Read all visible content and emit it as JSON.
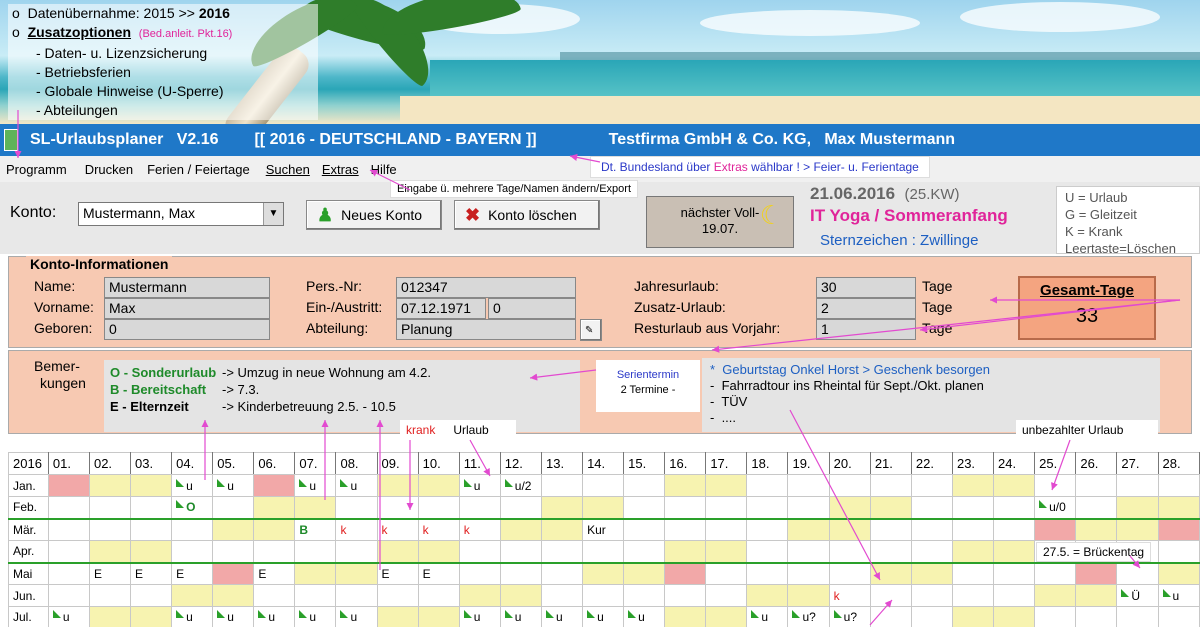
{
  "intro": {
    "line1_prefix": "Datenübernahme: 2015  >> ",
    "line1_bold": "2016",
    "line2_title": "Zusatzoptionen",
    "line2_note": "(Bed.anleit. Pkt.16)",
    "items": [
      "- Daten-  u. Lizenzsicherung",
      "- Betriebsferien",
      "- Globale Hinweise (U-Sperre)",
      "- Abteilungen"
    ]
  },
  "titlebar": {
    "app": "SL-Urlaubsplaner   V2.16",
    "region": "[[ 2016 - DEUTSCHLAND - BAYERN ]]",
    "company": "Testfirma GmbH & Co. KG,   Max Mustermann"
  },
  "menu": [
    "Programm",
    "Drucken",
    "Ferien / Feiertage",
    "Suchen",
    "Extras",
    "Hilfe"
  ],
  "hints": {
    "bundes_a": "Dt. Bundesland über ",
    "bundes_b": "Extras",
    "bundes_c": " wählbar !  > Feier- u. Ferientage",
    "eingabe": "Eingabe ü. mehrere Tage/Namen ändern/Export"
  },
  "toolbar": {
    "konto_label": "Konto:",
    "konto_value": "Mustermann, Max",
    "new_account": "Neues Konto",
    "delete_account": "Konto löschen",
    "moon_line1": "nächster Voll-",
    "moon_line2": "19.07.",
    "date": "21.06.2016",
    "kw": "(25.KW)",
    "event": "IT Yoga /  Sommeranfang",
    "zodiac": "Sternzeichen :  Zwillinge"
  },
  "legend": [
    "U = Urlaub",
    "G = Gleitzeit",
    "K = Krank",
    "Leertaste=Löschen"
  ],
  "account_info": {
    "title": "Konto-Informationen",
    "name_label": "Name:",
    "name": "Mustermann",
    "vorname_label": "Vorname:",
    "vorname": "Max",
    "geboren_label": "Geboren:",
    "geboren": "0",
    "persnr_label": "Pers.-Nr:",
    "persnr": "012347",
    "einaus_label": "Ein-/Austritt:",
    "eintritt": "07.12.1971",
    "austritt": "0",
    "abteilung_label": "Abteilung:",
    "abteilung": "Planung",
    "jahres_label": "Jahresurlaub:",
    "jahres": "30",
    "zusatz_label": "Zusatz-Urlaub:",
    "zusatz": "2",
    "rest_label": "Resturlaub aus Vorjahr:",
    "rest": "1",
    "tage": "Tage",
    "gesamt_label": "Gesamt-Tage",
    "gesamt": "33"
  },
  "remarks": {
    "label1": "Bemer-",
    "label2": "kungen",
    "rows": [
      {
        "k": "O - Sonderurlaub",
        "v": "->  Umzug in neue Wohnung am  4.2."
      },
      {
        "k": "B - Bereitschaft",
        "v": "->  7.3."
      },
      {
        "k": "E - Elternzeit",
        "v": "->  Kinderbetreuung  2.5. - 10.5"
      }
    ],
    "serien_title": "Serientermin",
    "serien_count": "2 Termine  -",
    "termine": [
      {
        "t": "Geburtstag Onkel Horst  > Geschenk besorgen",
        "blue": true
      },
      {
        "t": "Fahrradtour ins Rheintal für  Sept./Okt. planen",
        "blue": false
      },
      {
        "t": "TÜV",
        "blue": false
      },
      {
        "t": "....",
        "blue": false
      }
    ],
    "krank": "krank",
    "urlaub": "Urlaub",
    "unbezahlt": "unbezahlter Urlaub"
  },
  "calendar": {
    "year": "2016",
    "days": [
      "01.",
      "02.",
      "03.",
      "04.",
      "05.",
      "06.",
      "07.",
      "08.",
      "09.",
      "10.",
      "11.",
      "12.",
      "13.",
      "14.",
      "15.",
      "16.",
      "17.",
      "18.",
      "19.",
      "20.",
      "21.",
      "22.",
      "23.",
      "24.",
      "25.",
      "26.",
      "27.",
      "28."
    ],
    "months": [
      {
        "name": "Jan.",
        "cells": {
          "1": "hol",
          "2": "we",
          "3": "we",
          "4": "tri:u",
          "5": "tri:u",
          "6": "hol",
          "7": "tri:u",
          "8": "tri:u",
          "9": "we",
          "10": "we",
          "11": "tri:u",
          "12": "tri:u/2",
          "16": "we",
          "17": "we",
          "23": "we",
          "24": "we"
        }
      },
      {
        "name": "Feb.",
        "cells": {
          "4": "tri:gO",
          "6": "we",
          "7": "we",
          "13": "we",
          "14": "we",
          "20": "we",
          "21": "we",
          "25": "tri:u/0",
          "27": "we",
          "28": "we"
        }
      },
      {
        "name": "Mär.",
        "cells": {
          "5": "we",
          "6": "we",
          "7": "gB",
          "8": "rk",
          "9": "rk",
          "10": "rk",
          "11": "rk",
          "12": "we",
          "13": "we",
          "14": "Kur",
          "19": "we",
          "20": "we",
          "25": "hol",
          "26": "we",
          "27": "we",
          "28": "hol"
        }
      },
      {
        "name": "Apr.",
        "cells": {
          "2": "we",
          "3": "we",
          "9": "we",
          "10": "we",
          "16": "we",
          "17": "we",
          "23": "we",
          "24": "we"
        }
      },
      {
        "name": "Mai",
        "cells": {
          "2": "E",
          "3": "E",
          "4": "E",
          "5": "hol",
          "6": "E",
          "7": "we",
          "8": "we",
          "9": "E",
          "10": "E",
          "14": "we",
          "15": "we",
          "16": "hol",
          "21": "we",
          "22": "we",
          "26": "hol",
          "28": "we"
        }
      },
      {
        "name": "Jun.",
        "cells": {
          "4": "we",
          "5": "we",
          "11": "we",
          "12": "we",
          "18": "we",
          "19": "we",
          "20": "rk",
          "25": "we",
          "26": "we",
          "27": "tri:Ü",
          "28": "tri:u"
        }
      },
      {
        "name": "Jul.",
        "cells": {
          "1": "tri:u",
          "2": "we",
          "3": "we",
          "4": "tri:u",
          "5": "tri:u",
          "6": "tri:u",
          "7": "tri:u",
          "8": "tri:u",
          "9": "we",
          "10": "we",
          "11": "tri:u",
          "12": "tri:u",
          "13": "tri:u",
          "14": "tri:u",
          "15": "tri:u",
          "16": "we",
          "17": "we",
          "18": "tri:u",
          "19": "tri:u?",
          "20": "tri:u?",
          "23": "we",
          "24": "we"
        }
      }
    ],
    "bruecke": "27.5. = Brückentag"
  }
}
